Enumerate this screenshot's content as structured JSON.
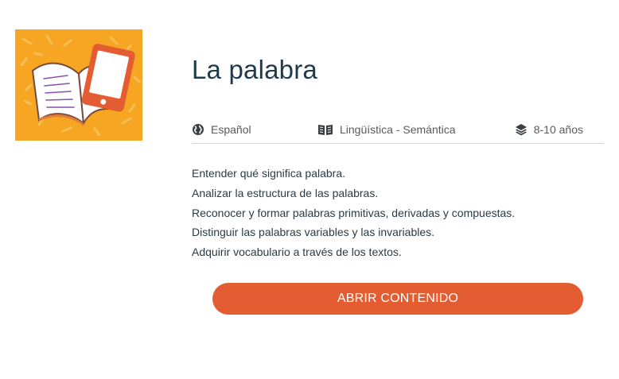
{
  "resource": {
    "title": "La palabra",
    "thumbnail_icon": "book-and-tablet-icon",
    "thumbnail_bg": "#f6a623"
  },
  "meta": {
    "language": "Español",
    "language_icon": "globe-icon",
    "subject": "Lingüística - Semántica",
    "subject_icon": "open-book-icon",
    "age": "8-10 años",
    "age_icon": "layers-icon"
  },
  "objectives": [
    "Entender qué significa palabra.",
    "Analizar la estructura de las palabras.",
    "Reconocer y formar palabras primitivas, derivadas y compuestas.",
    "Distinguir las palabras variables y las invariables.",
    "Adquirir vocabulario a través de los textos."
  ],
  "cta": {
    "label": "ABRIR CONTENIDO",
    "color": "#e45c32"
  }
}
